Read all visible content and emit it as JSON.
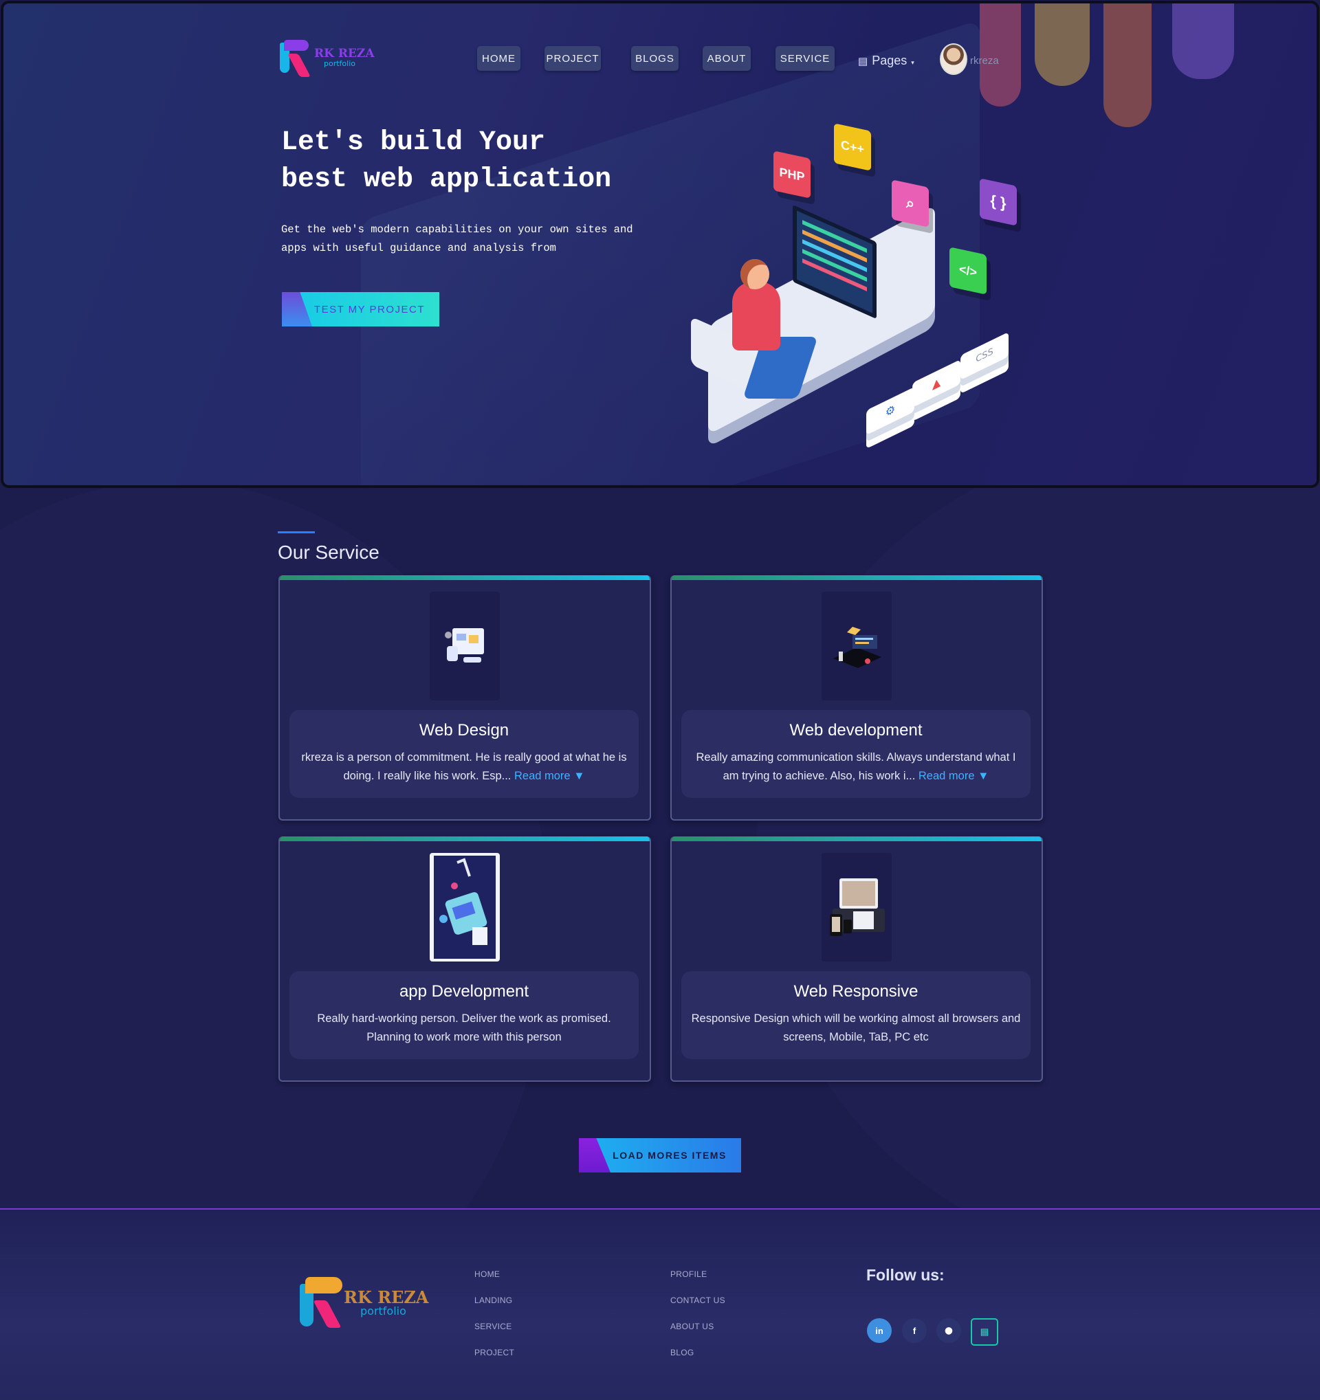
{
  "colors": {
    "page_bg": "#1c1c4d",
    "accent_cyan": "#1ac0e8",
    "accent_blue": "#2a7fff",
    "accent_purple": "#7a3bcf",
    "card_bg": "#222456",
    "link": "#3ab4ff"
  },
  "brand": {
    "name": "RK REZA",
    "tagline": "portfolio"
  },
  "nav": {
    "items": [
      {
        "label": "HOME"
      },
      {
        "label": "PROJECT"
      },
      {
        "label": "BLOGS"
      },
      {
        "label": "ABOUT"
      },
      {
        "label": "SERVICE"
      }
    ],
    "pages_label": "Pages",
    "pages_icon": "document-icon",
    "dropdown_icon": "chevron-down-icon",
    "username": "rkreza"
  },
  "hero": {
    "title": "Let's build Your\nbest web application",
    "subtitle": "Get the web's modern capabilities on your own sites and apps with useful guidance and analysis from",
    "cta_label": "TEST MY PROJECT",
    "illustration_tags": [
      "PHP",
      "C++",
      "{ }",
      "</>",
      "CSS"
    ]
  },
  "services": {
    "heading": "Our Service",
    "cards": [
      {
        "title": "Web Design",
        "text": "rkreza is a person of commitment. He is really good at what he is doing. I really like his work. Esp...",
        "read_more": "Read more ▼",
        "icon": "web-design-illustration"
      },
      {
        "title": "Web development",
        "text": "Really amazing communication skills. Always understand what I am trying to achieve. Also, his work i...",
        "read_more": "Read more ▼",
        "icon": "web-development-illustration"
      },
      {
        "title": "app Development",
        "text": "Really hard-working person. Deliver the work as promised. Planning to work more with this person",
        "read_more": "",
        "icon": "app-development-illustration"
      },
      {
        "title": "Web Responsive",
        "text": "Responsive Design which will be working almost all browsers and screens, Mobile, TaB, PC etc",
        "read_more": "",
        "icon": "responsive-devices-illustration"
      }
    ],
    "load_more_label": "LOAD MORES ITEMS"
  },
  "footer": {
    "links_col1": [
      "HOME",
      "LANDING",
      "SERVICE",
      "PROJECT"
    ],
    "links_col2": [
      "PROFILE",
      "CONTACT US",
      "ABOUT US",
      "BLOG"
    ],
    "follow_heading": "Follow us:",
    "social": [
      {
        "name": "linkedin-icon",
        "glyph": "in"
      },
      {
        "name": "facebook-icon",
        "glyph": "f"
      },
      {
        "name": "github-icon",
        "glyph": "⬤"
      },
      {
        "name": "resume-icon",
        "glyph": "▤"
      }
    ]
  }
}
